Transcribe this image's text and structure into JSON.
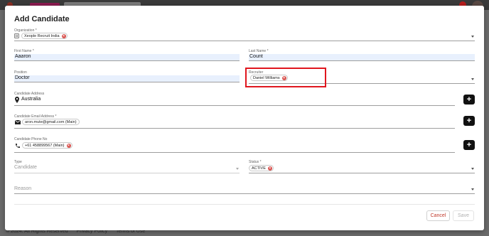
{
  "footer": {
    "copyright": "© 2024. All Rights Reserved",
    "privacy": "Privacy Policy",
    "terms": "Terms of Use"
  },
  "dialog": {
    "title": "Add Candidate",
    "organization": {
      "label": "Organization *",
      "chip": "Xeople Recruit India"
    },
    "first_name": {
      "label": "First Name *",
      "value": "Aaaron"
    },
    "last_name": {
      "label": "Last Name *",
      "value": "Count"
    },
    "position": {
      "label": "Position",
      "value": "Doctor"
    },
    "recruiter": {
      "label": "Recruiter",
      "chip": "Daniel Williams"
    },
    "address": {
      "label": "Candidate Address",
      "value": "Australia"
    },
    "email": {
      "label": "Candidate Email Address *",
      "chip": "aron.mute@gmail.com (Main)"
    },
    "phone": {
      "label": "Candidate Phone No",
      "chip": "+61 458899567 (Main)"
    },
    "type": {
      "label": "Type",
      "value": "Candidate"
    },
    "status": {
      "label": "Status *",
      "chip": "ACTIVE"
    },
    "reason": {
      "label": "Reason"
    },
    "add_symbol": "+",
    "remove_symbol": "×",
    "actions": {
      "cancel": "Cancel",
      "save": "Save"
    }
  },
  "colors": {
    "highlight": "#e0161e",
    "chip_remove": "#d9534f",
    "filled_input": "#e8f0fd",
    "cancel_text": "#c0392b"
  }
}
